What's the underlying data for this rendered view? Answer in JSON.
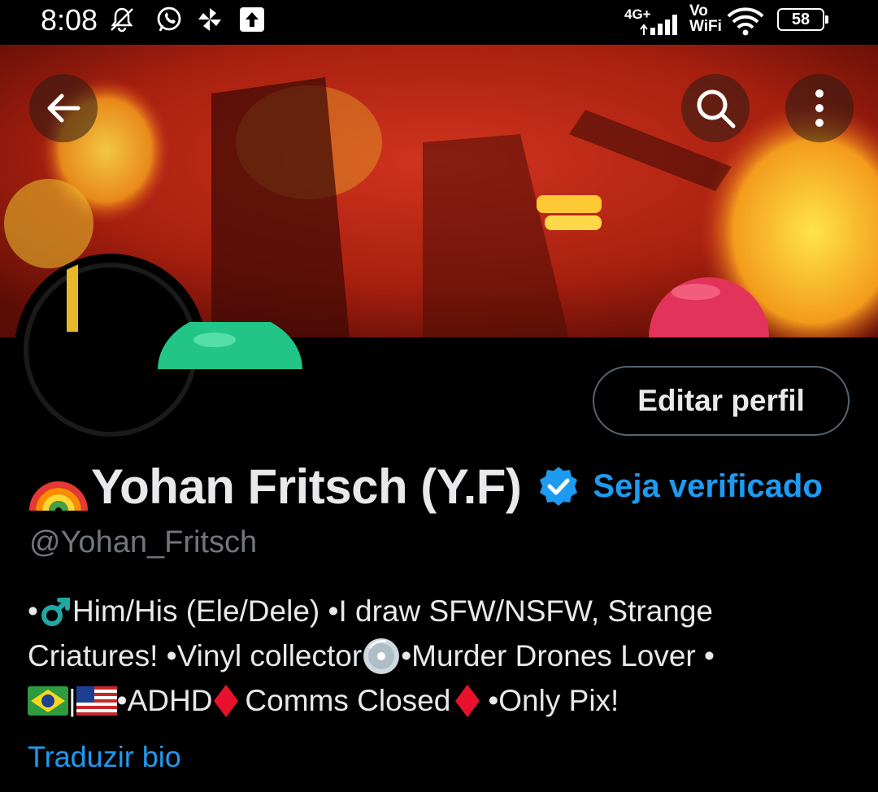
{
  "status_bar": {
    "time": "8:08",
    "network": "4G+",
    "volte_top": "Vo",
    "volte_bottom": "WiFi",
    "battery": "58",
    "icons": [
      "mute-icon",
      "whatsapp-icon",
      "pinwheel-icon",
      "upload-icon",
      "signal-icon",
      "wifi-icon",
      "battery-icon"
    ]
  },
  "header": {
    "back_icon": "back-arrow-icon",
    "search_icon": "search-icon",
    "more_icon": "more-vertical-icon"
  },
  "profile": {
    "edit_label": "Editar perfil",
    "name": "Yohan Fritsch (Y.F)",
    "name_emoji": "rainbow-emoji",
    "get_verified_label": "Seja verificado",
    "handle": "@Yohan_Fritsch",
    "bio": {
      "line1_a": "•",
      "line1_b": " Him/His (Ele/Dele) •I draw SFW/NSFW, Strange",
      "line2_a": "Criatures! •Vinyl collector",
      "line2_b": " •Murder Drones Lover •",
      "line3_a": "|",
      "line3_b": " •ADHD ",
      "line3_c": "Comms Closed",
      "line3_d": " •Only Pix!"
    },
    "translate_label": "Traduzir bio"
  },
  "colors": {
    "background": "#000000",
    "text_primary": "#e7e9ea",
    "text_secondary": "#71767b",
    "accent": "#1d9bf0",
    "border": "#536471"
  }
}
